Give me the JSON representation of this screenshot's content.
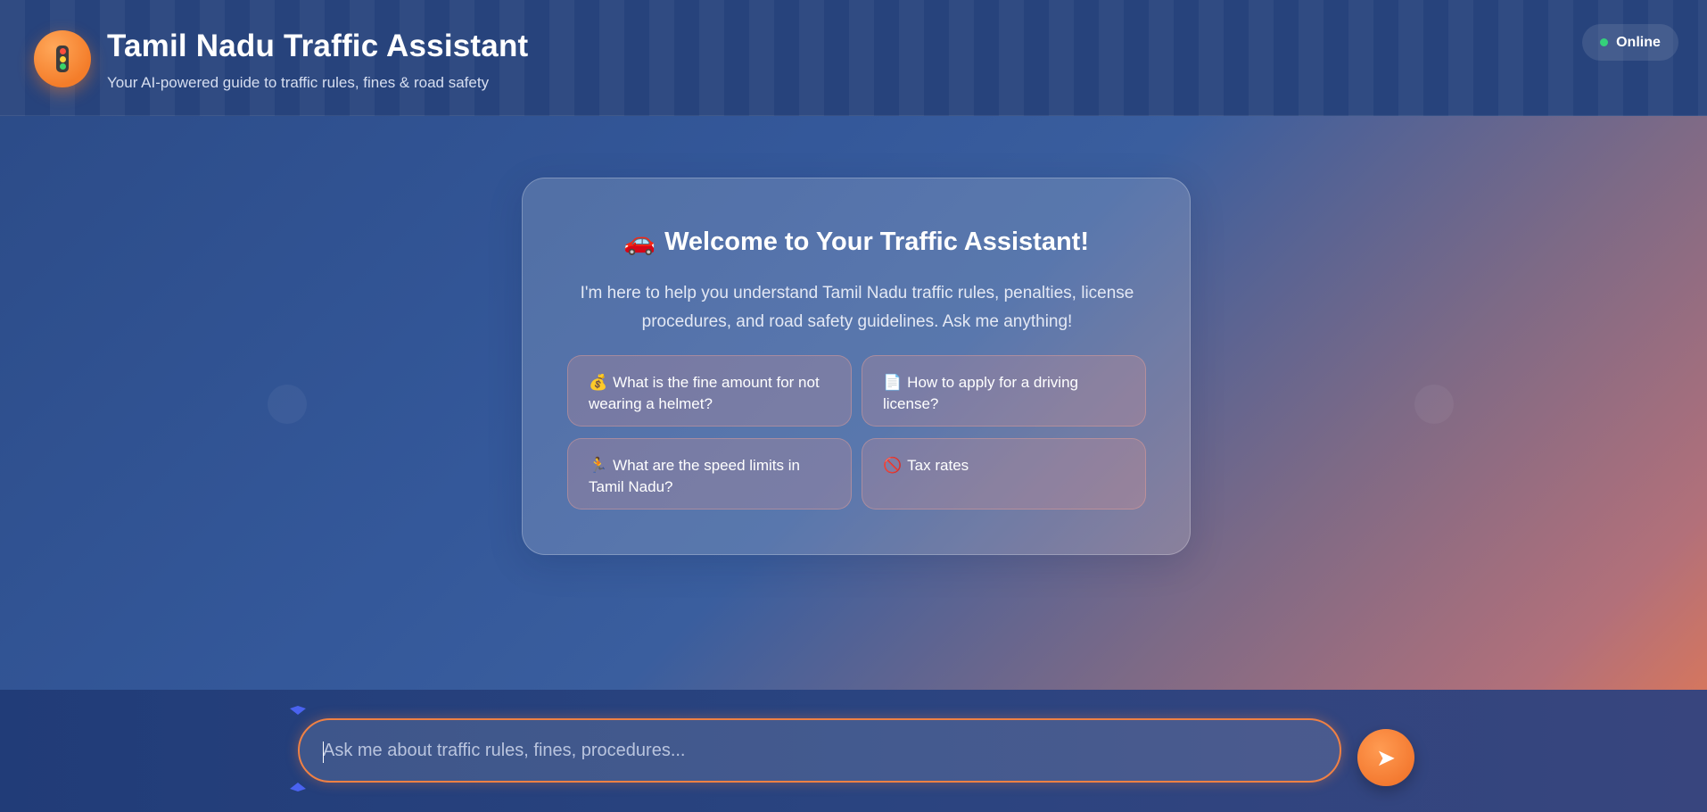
{
  "header": {
    "logo_icon": "traffic-light-icon",
    "title": "Tamil Nadu Traffic Assistant",
    "subtitle": "Your AI-powered guide to traffic rules, fines & road safety",
    "status_label": "Online",
    "status_color": "#34d17a"
  },
  "welcome": {
    "icon": "🚗",
    "title": "Welcome to Your Traffic Assistant!",
    "text": "I'm here to help you understand Tamil Nadu traffic rules, penalties, license procedures, and road safety guidelines. Ask me anything!",
    "suggestions": [
      {
        "icon": "💰",
        "label": "What is the fine amount for not wearing a helmet?"
      },
      {
        "icon": "📄",
        "label": "How to apply for a driving license?"
      },
      {
        "icon": "🏃",
        "label": "What are the speed limits in Tamil Nadu?"
      },
      {
        "icon": "🚫",
        "label": "Tax rates"
      }
    ]
  },
  "chat_input": {
    "placeholder": "Ask me about traffic rules, fines, procedures...",
    "value": ""
  },
  "send_button": {
    "icon": "send-arrow-icon",
    "glyph": "➤"
  },
  "colors": {
    "accent": "#f47d2a",
    "header_bg": "#27437c",
    "input_border": "#f08144"
  }
}
